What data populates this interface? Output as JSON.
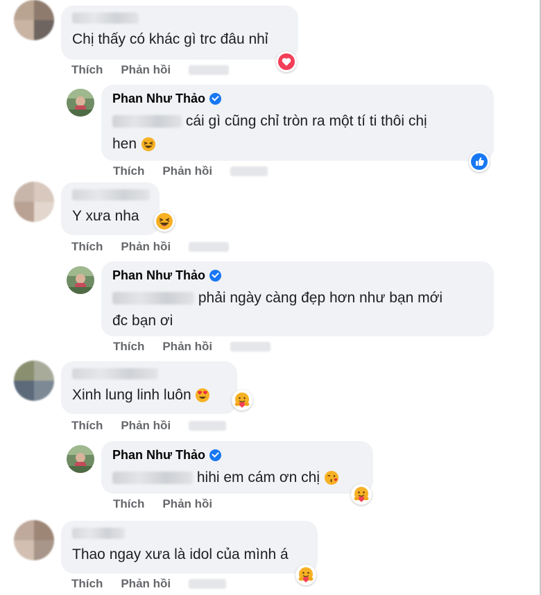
{
  "actions": {
    "like_label": "Thích",
    "reply_label": "Phản hồi"
  },
  "reply_author": "Phan Như Thảo",
  "comments": [
    {
      "text": "Chị thấy có khác gì trc đâu nhỉ",
      "reaction": "heart"
    },
    {
      "text": "cái gì cũng chỉ tròn ra một tí ti thôi chị",
      "text2": "hen",
      "reaction": "like"
    },
    {
      "text": "Y xưa nha",
      "reaction": "haha"
    },
    {
      "text": "phải ngày càng đẹp hơn như bạn mới",
      "text2": "đc bạn ơi"
    },
    {
      "text": "Xinh lung linh luôn",
      "reaction": "care"
    },
    {
      "text": "hihi em cám ơn chị",
      "reaction": "care"
    },
    {
      "text": "Thao ngay xưa là idol của mình á",
      "reaction": "care"
    }
  ],
  "colors": {
    "bubble": "#f0f2f5",
    "action_text": "#65676b",
    "verified": "#1877f2",
    "heart": "#f33e58",
    "like": "#1877f2",
    "emoji_yellow": "#f7b125"
  }
}
